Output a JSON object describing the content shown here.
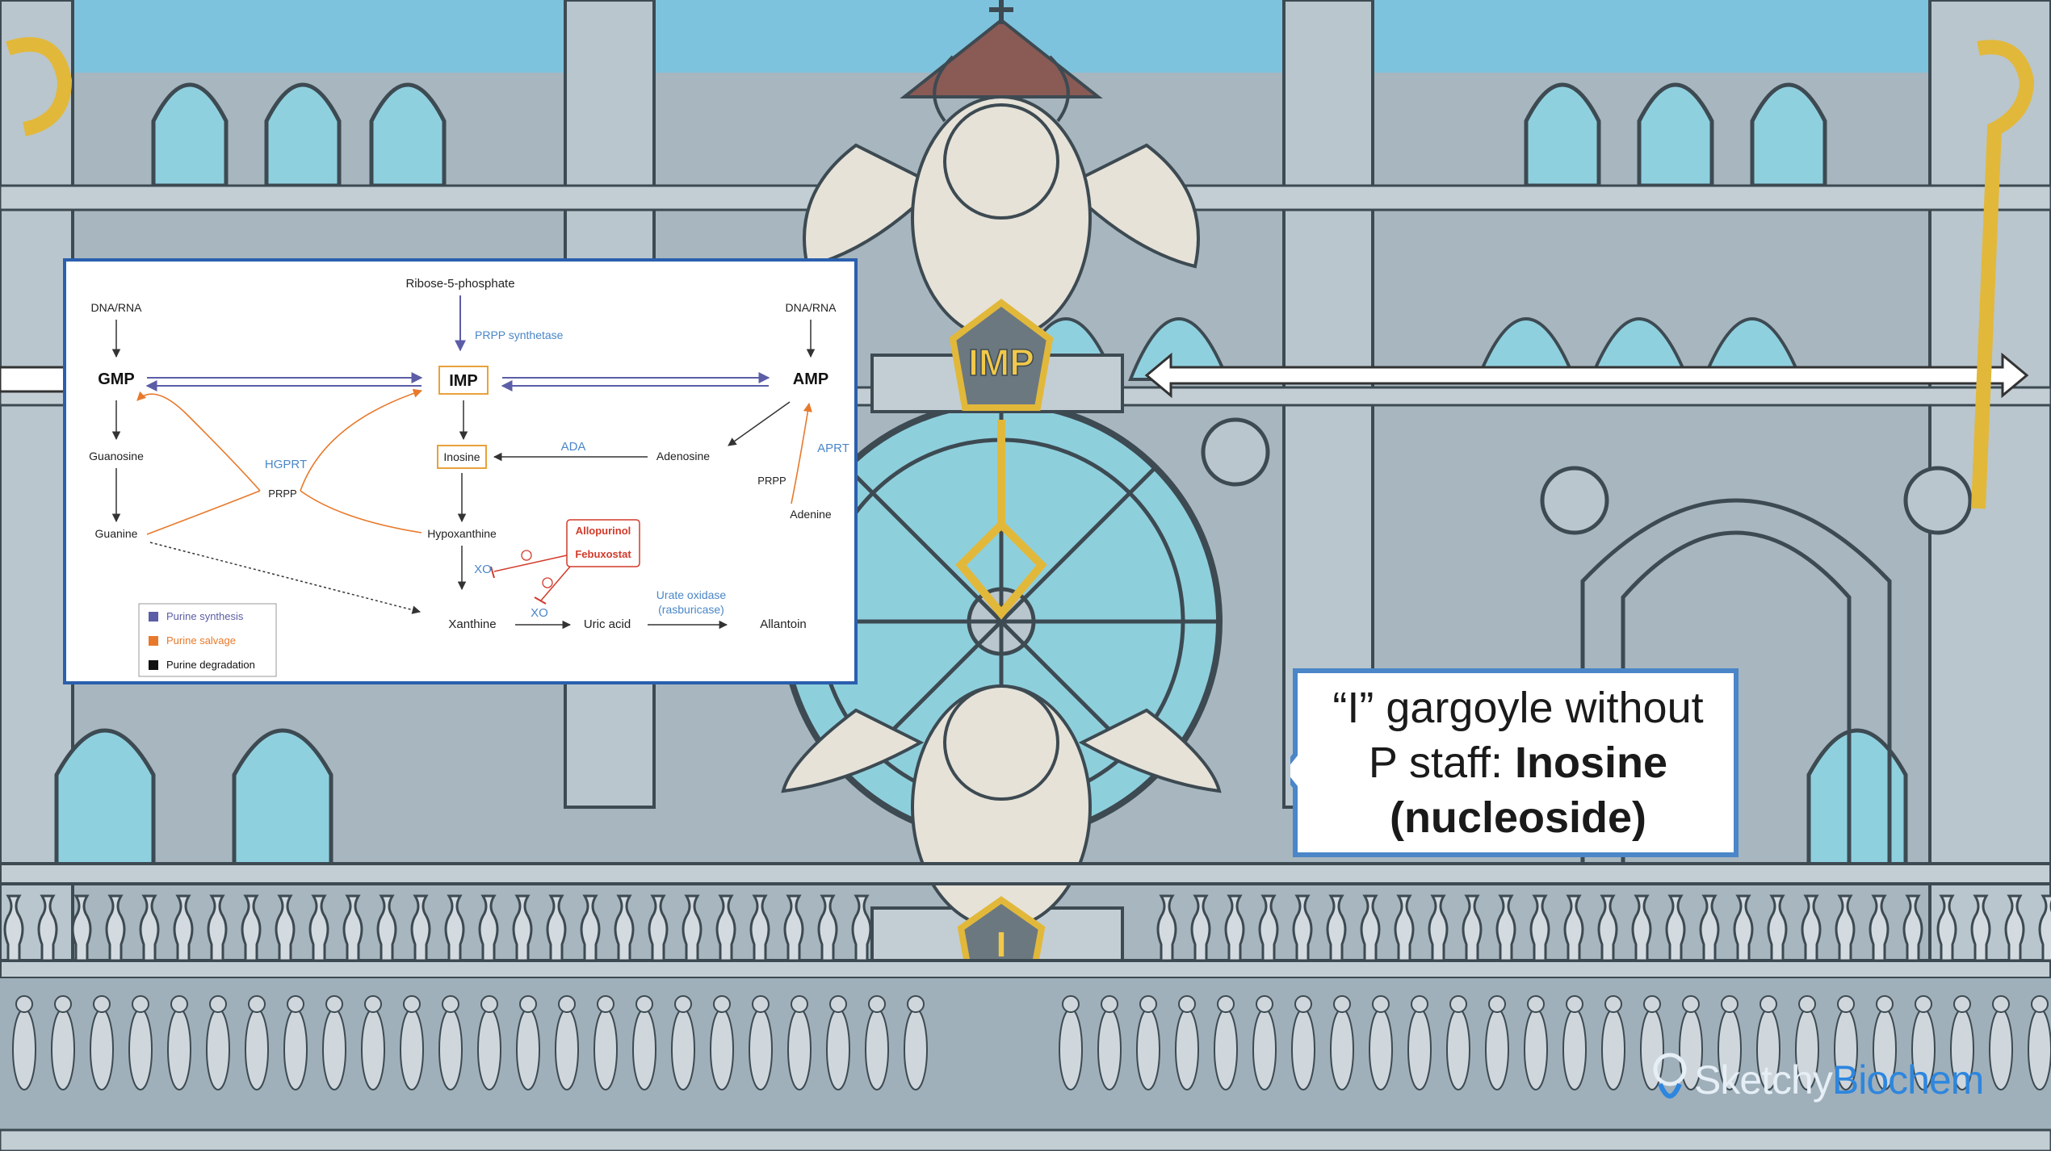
{
  "diagram": {
    "top_source": "Ribose-5-phosphate",
    "prpp_synthetase": "PRPP synthetase",
    "dna_rna_left": "DNA/RNA",
    "dna_rna_right": "DNA/RNA",
    "gmp": "GMP",
    "imp": "IMP",
    "amp": "AMP",
    "guanosine": "Guanosine",
    "inosine": "Inosine",
    "adenosine": "Adenosine",
    "hgprt": "HGPRT",
    "prpp_left": "PRPP",
    "ada": "ADA",
    "aprt": "APRT",
    "prpp_right": "PRPP",
    "adenine": "Adenine",
    "guanine": "Guanine",
    "hypoxanthine": "Hypoxanthine",
    "allopurinol": "Allopurinol",
    "febuxostat": "Febuxostat",
    "xo_1": "XO",
    "xo_2": "XO",
    "xanthine": "Xanthine",
    "uric_acid": "Uric acid",
    "urate_oxidase": "Urate oxidase",
    "rasburicase": "(rasburicase)",
    "allantoin": "Allantoin",
    "legend": [
      {
        "label": "Purine synthesis",
        "color": "#5b5ea6"
      },
      {
        "label": "Purine salvage",
        "color": "#e8792b"
      },
      {
        "label": "Purine degradation",
        "color": "#111111"
      }
    ],
    "colors": {
      "synthesis": "#5b5ea6",
      "salvage": "#e8792b",
      "enzyme_blue": "#4a86c8",
      "inhibitor_red": "#d23a2a"
    }
  },
  "scene": {
    "imp_plaque": "IMP",
    "i_plaque": "I"
  },
  "callout": {
    "line1": "“I” gargoyle without",
    "line2_normal": "P staff: ",
    "line2_bold": "Inosine",
    "line3_bold": "(nucleoside)"
  },
  "brand": {
    "part1": "Sketchy",
    "part2": "Biochem"
  }
}
